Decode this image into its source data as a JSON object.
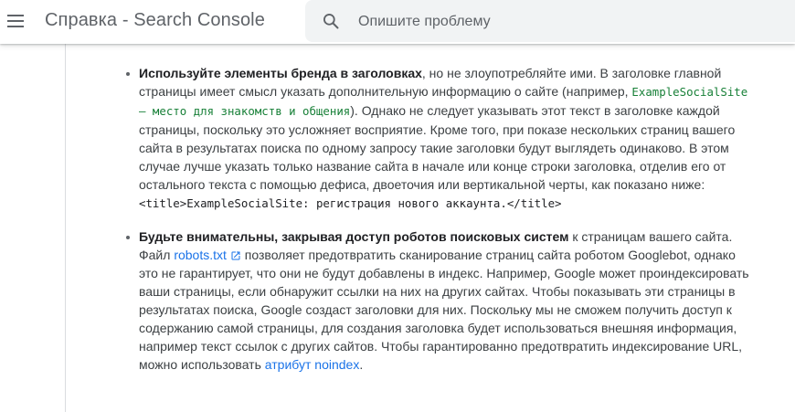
{
  "header": {
    "title": "Справка - Search Console",
    "search_placeholder": "Опишите проблему",
    "menu_icon": "menu-icon",
    "search_icon": "search-icon"
  },
  "article": {
    "item1": {
      "bold": "Используйте элементы бренда в заголовках",
      "t1": ", но не злоупотребляйте ими. В заголовке главной страницы имеет смысл указать дополнительную информацию о сайте (например, ",
      "code": "ExampleSocialSite – место для знакомств и общения",
      "t2": "). Однако не следует указывать этот текст в заголовке каждой страницы, поскольку это усложняет восприятие. Кроме того, при показе нескольких страниц вашего сайта в результатах поиска по одному запросу такие заголовки будут выглядеть одинаково. В этом случае лучше указать только название сайта в начале или конце строки заголовка, отделив его от остального текста с помощью дефиса, двоеточия или вертикальной черты, как показано ниже:",
      "code_example": "<title>ExampleSocialSite: регистрация нового аккаунта.</title>"
    },
    "item2": {
      "bold": "Будьте внимательны, закрывая доступ роботов поисковых систем",
      "t1": " к страницам вашего сайта. Файл ",
      "link1": "robots.txt",
      "link1_icon": "external-link-icon",
      "t2": " позволяет предотвратить сканирование страниц сайта роботом Googlebot, однако это не гарантирует, что они не будут добавлены в индекс. Например, Google может проиндексировать ваши страницы, если обнаружит ссылки на них на других сайтах. Чтобы показывать эти страницы в результатах поиска, Google создаст заголовки для них. Поскольку мы не сможем получить доступ к содержанию самой страницы, для создания заголовка будет использоваться внешняя информация, например текст ссылок с других сайтов. Чтобы гарантированно предотвратить индексирование URL, можно использовать ",
      "link2": "атрибут noindex",
      "t3": "."
    }
  },
  "colors": {
    "link": "#1a73e8",
    "code_green": "#188038",
    "search_bg": "#f1f3f4"
  }
}
